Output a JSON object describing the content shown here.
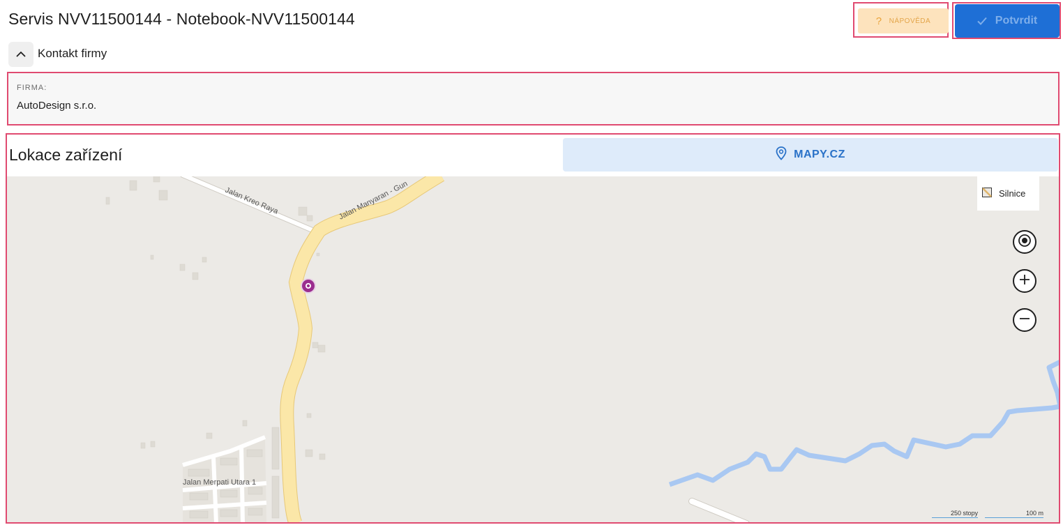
{
  "header": {
    "title": "Servis NVV11500144 - Notebook-NVV11500144",
    "help_label": "NÁPOVĚDA",
    "confirm_label": "Potvrdit"
  },
  "contact_section": {
    "label": "Kontakt firmy",
    "company_key": "FIRMA:",
    "company_value": "AutoDesign s.r.o."
  },
  "location": {
    "title": "Lokace zařízení",
    "map_button_label": "MAPY.CZ",
    "layer_toggle_label": "Silnice",
    "street_labels": [
      "Jalan Kreo Raya",
      "Jalan Manyaran - Gun",
      "Jalan Merpati Utara 1"
    ],
    "scale": {
      "imperial": "250 stopy",
      "metric": "100 m"
    }
  },
  "colors": {
    "accent": "#1e6fd6",
    "help_bg": "#fde3bd",
    "highlight_border": "#e04a70",
    "marker": "#9b2d8e",
    "river": "#a9c8f2",
    "road": "#fbe7a8"
  }
}
